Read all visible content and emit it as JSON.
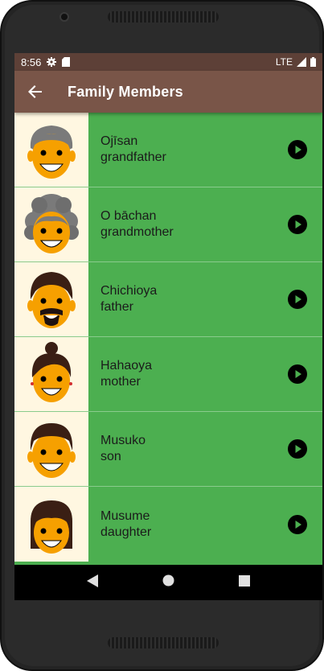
{
  "status_bar": {
    "time": "8:56",
    "network": "LTE"
  },
  "app_bar": {
    "title": "Family Members",
    "back_icon": "arrow-back-icon"
  },
  "members": [
    {
      "japanese": "Ojīsan",
      "english": "grandfather",
      "avatar": "grandfather-icon"
    },
    {
      "japanese": "O bāchan",
      "english": "grandmother",
      "avatar": "grandmother-icon"
    },
    {
      "japanese": "Chichioya",
      "english": "father",
      "avatar": "father-icon"
    },
    {
      "japanese": "Hahaoya",
      "english": "mother",
      "avatar": "mother-icon"
    },
    {
      "japanese": "Musuko",
      "english": "son",
      "avatar": "son-icon"
    },
    {
      "japanese": "Musume",
      "english": "daughter",
      "avatar": "daughter-icon"
    }
  ],
  "colors": {
    "status_bar": "#5d4037",
    "app_bar": "#795548",
    "list_background": "#4caf50",
    "avatar_background": "#fff7e1",
    "skin": "#f6a000"
  }
}
